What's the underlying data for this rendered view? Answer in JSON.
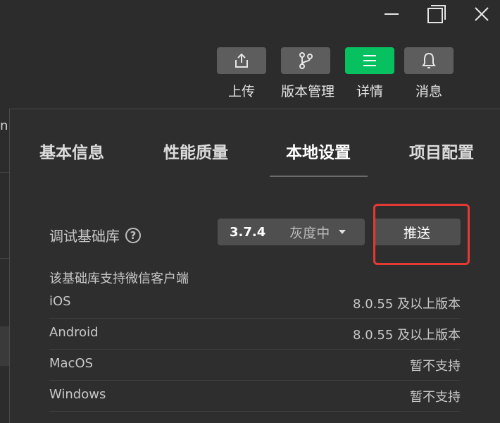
{
  "window": {
    "icons": {
      "minimize": "minimize-icon",
      "maximize": "maximize-icon",
      "close": "close-icon"
    }
  },
  "toolbar": {
    "upload_label": "上传",
    "version_label": "版本管理",
    "details_label": "详情",
    "messages_label": "消息",
    "active_color": "#07c160"
  },
  "background": {
    "edge_text": "n"
  },
  "panel": {
    "tabs": [
      {
        "label": "基本信息"
      },
      {
        "label": "性能质量"
      },
      {
        "label": "本地设置",
        "active": true
      },
      {
        "label": "项目配置"
      }
    ],
    "debug_lib": {
      "label": "调试基础库",
      "help": "?",
      "version": "3.7.4",
      "state": "灰度中",
      "push_label": "推送",
      "highlight_color": "#e53a34"
    },
    "support_title": "该基础库支持微信客户端",
    "clients": [
      {
        "name": "iOS",
        "value": "8.0.55 及以上版本"
      },
      {
        "name": "Android",
        "value": "8.0.55 及以上版本"
      },
      {
        "name": "MacOS",
        "value": "暂不支持"
      },
      {
        "name": "Windows",
        "value": "暂不支持"
      }
    ]
  }
}
